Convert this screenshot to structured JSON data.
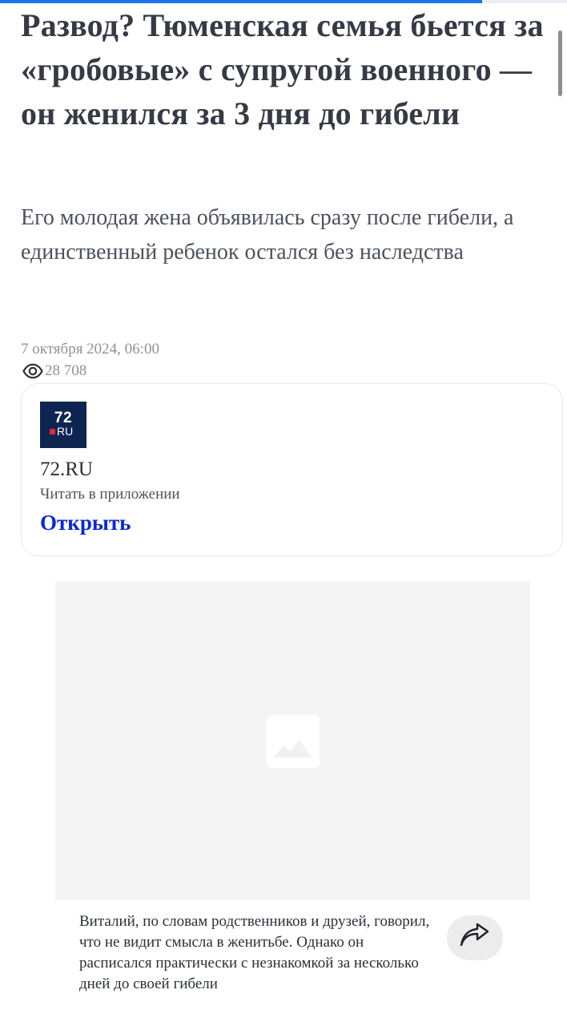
{
  "reading_progress": 0.85,
  "article": {
    "title": "Развод? Тюменская семья бьется за «гробовые» с супругой военного — он женился за 3 дня до гибели",
    "subtitle": "Его молодая жена объявилась сразу после гибели, а единственный ребенок остался без наследства",
    "date": "7 октября 2024, 06:00",
    "views": "28 708",
    "views_icon": "eye-icon"
  },
  "app_card": {
    "logo_number": "72",
    "logo_ru": "RU",
    "logo_colors": {
      "background": "#0d2550",
      "accent": "#e2263b"
    },
    "name": "72.RU",
    "tagline": "Читать в приложении",
    "open_label": "Открыть",
    "open_color": "#0b28d6"
  },
  "media": {
    "placeholder_icon": "image-placeholder-icon",
    "caption": "Виталий, по словам родственников и друзей, говорил, что не видит смысла в женитьбе. Однако он расписался практически с незнакомкой за несколько дней до своей гибели",
    "share_icon": "share-arrow-icon"
  },
  "colors": {
    "progress": "#1a73e8",
    "headline": "#363a45",
    "muted": "#8d9199"
  }
}
